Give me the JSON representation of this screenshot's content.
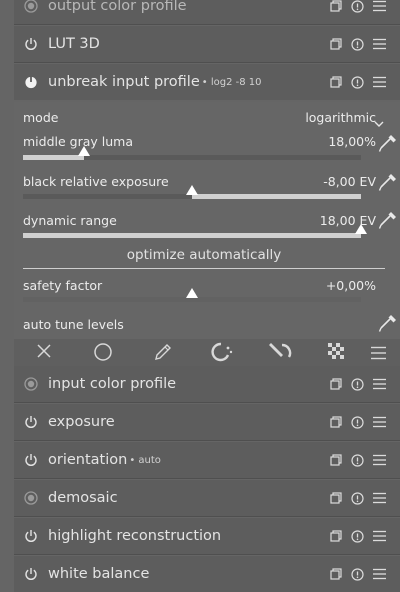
{
  "modules_top": [
    {
      "name": "output color profile",
      "icon": "active-circle-icon",
      "label": ""
    },
    {
      "name": "LUT 3D",
      "icon": "power-icon",
      "label": ""
    },
    {
      "name": "unbreak input profile",
      "icon": "power-icon-on",
      "label": "log2 -8 10"
    }
  ],
  "unbreak": {
    "mode_label": "mode",
    "mode_value": "logarithmic",
    "middle_gray_label": "middle gray luma",
    "middle_gray_value": "18,00%",
    "middle_gray_level": 0.18,
    "black_exposure_label": "black relative exposure",
    "black_exposure_value": "-8,00 EV",
    "black_exposure_level": 0.5,
    "dynamic_range_label": "dynamic range",
    "dynamic_range_value": "18,00 EV",
    "dynamic_range_level": 1.0,
    "optimize_label": "optimize automatically",
    "safety_label": "safety factor",
    "safety_value": "+0,00%",
    "safety_level": 0.5,
    "autotune_label": "auto tune levels"
  },
  "mask_toolbar": {
    "icons": [
      "off-x-icon",
      "uniform-circle-icon",
      "drawn-pencil-icon",
      "parametric-icon",
      "drawn-parametric-icon",
      "raster-icon",
      "menu-icon"
    ]
  },
  "modules_bottom": [
    {
      "name": "input color profile",
      "icon": "active-circle-icon",
      "label": ""
    },
    {
      "name": "exposure",
      "icon": "power-icon",
      "label": ""
    },
    {
      "name": "orientation",
      "icon": "power-icon",
      "label": "auto"
    },
    {
      "name": "demosaic",
      "icon": "active-circle-icon",
      "label": ""
    },
    {
      "name": "highlight reconstruction",
      "icon": "power-icon",
      "label": ""
    },
    {
      "name": "white balance",
      "icon": "power-icon",
      "label": ""
    }
  ],
  "colors": {
    "background": "#656565",
    "header": "#5d5d5d",
    "text": "#e4e4e4"
  }
}
